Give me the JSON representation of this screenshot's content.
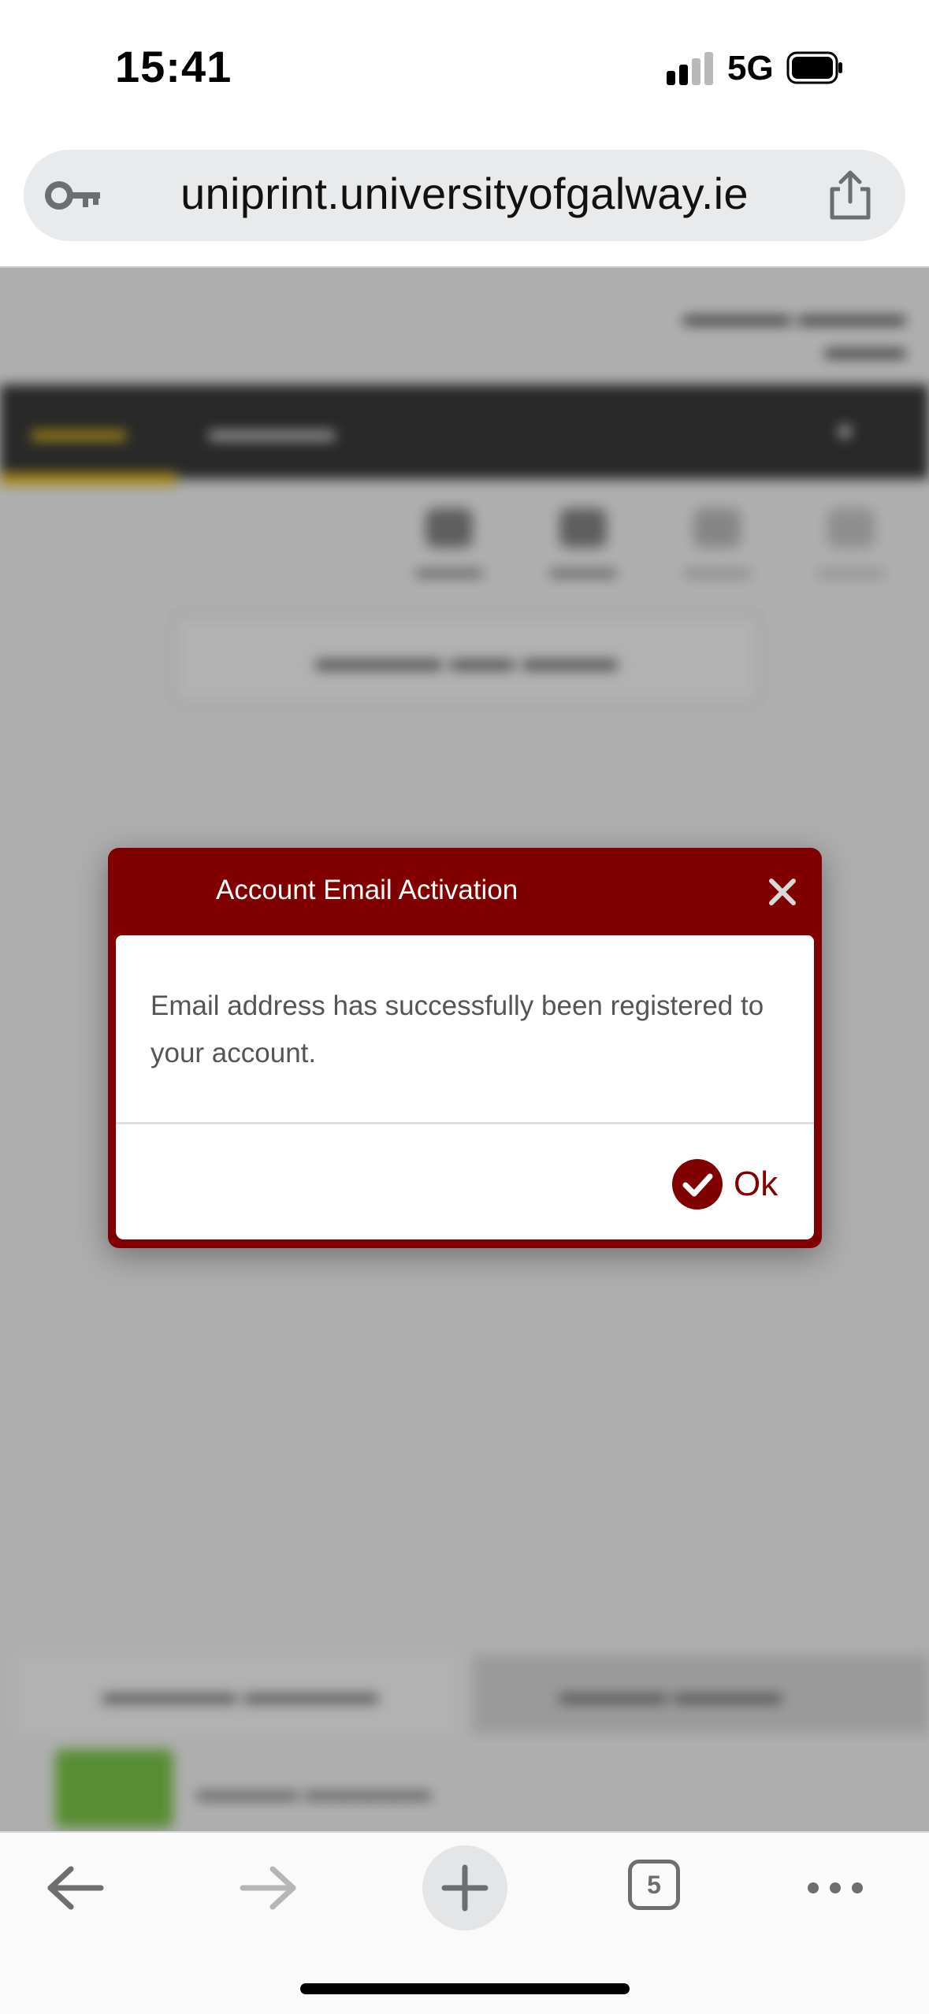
{
  "status_bar": {
    "time": "15:41",
    "network": "5G",
    "signal_icon": "cellular-signal-icon",
    "battery_icon": "battery-icon"
  },
  "browser": {
    "url": "uniprint.universityofgalway.ie",
    "key_icon": "key-icon",
    "share_icon": "share-icon"
  },
  "modal": {
    "title": "Account Email Activation",
    "message": "Email address has successfully been registered to your account.",
    "ok_label": "Ok",
    "close_icon": "close-icon",
    "ok_icon": "checkmark-circle-icon",
    "accent_color": "#800000"
  },
  "toolbar": {
    "tab_count": "5",
    "icons": [
      "back-arrow-icon",
      "forward-arrow-icon",
      "plus-icon",
      "tabs-icon",
      "more-icon"
    ]
  }
}
